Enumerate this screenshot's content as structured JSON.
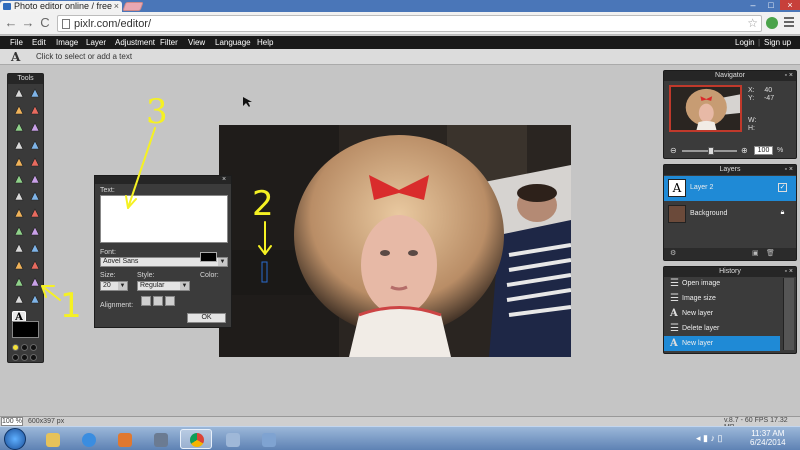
{
  "browser": {
    "tab_title": "Photo editor online / free",
    "tab_close": "×",
    "url": "pixlr.com/editor/",
    "window_controls": {
      "minimize": "–",
      "maximize": "□",
      "close": "×"
    },
    "nav": {
      "back": "←",
      "forward": "→",
      "reload": "C"
    },
    "star_icon": "☆"
  },
  "menubar": {
    "items": [
      "File",
      "Edit",
      "Image",
      "Layer",
      "Adjustment",
      "Filter",
      "View",
      "Language",
      "Help"
    ],
    "login": "Login",
    "signup": "Sign up"
  },
  "options_bar": {
    "tool_glyph": "A",
    "hint": "Click to select or add a text"
  },
  "tools_panel": {
    "title": "Tools",
    "tools": [
      "crop-icon",
      "move-icon",
      "marquee-icon",
      "lasso-icon",
      "wand-icon",
      "pencil-icon",
      "brush-icon",
      "eraser-icon",
      "bucket-icon",
      "gradient-icon",
      "stamp-icon",
      "color-replace-icon",
      "drawing-icon",
      "bloat-icon",
      "pinch-icon",
      "sharpen-icon",
      "blur-icon",
      "smudge-icon",
      "sponge-icon",
      "dodge-icon",
      "burn-icon",
      "red-eye-icon",
      "spot-heal-icon",
      "hand-icon",
      "zoom-icon",
      "picker-icon",
      "text-tool-icon"
    ],
    "fg_color": "#000000"
  },
  "text_dialog": {
    "text_label": "Text:",
    "text_value": "",
    "font_label": "Font:",
    "font_value": "Aovel Sans",
    "size_label": "Size:",
    "size_value": "20",
    "style_label": "Style:",
    "style_value": "Regular",
    "color_label": "Color:",
    "color_value": "#000000",
    "alignment_label": "Alignment:",
    "ok": "OK",
    "close": "×"
  },
  "navigator": {
    "title": "Navigator",
    "x_label": "X:",
    "x_value": "40",
    "y_label": "Y:",
    "y_value": "-47",
    "w_label": "W:",
    "w_value": "",
    "h_label": "H:",
    "h_value": "",
    "zoom": "100",
    "zoom_unit": "%"
  },
  "layers": {
    "title": "Layers",
    "items": [
      {
        "name": "Layer 2",
        "selected": true,
        "visible": true
      },
      {
        "name": "Background",
        "selected": false,
        "visible": true
      }
    ]
  },
  "history": {
    "title": "History",
    "items": [
      {
        "label": "Open image",
        "selected": false
      },
      {
        "label": "Image size",
        "selected": false
      },
      {
        "label": "New layer",
        "selected": false
      },
      {
        "label": "Delete layer",
        "selected": false
      },
      {
        "label": "New layer",
        "selected": true
      }
    ]
  },
  "status": {
    "zoom": "100",
    "zoom_unit": "%",
    "dimensions": "600x397 px",
    "version": "v.8.7 - 60 FPS 17.32 MB"
  },
  "taskbar": {
    "time": "11:37 AM",
    "date": "6/24/2014"
  },
  "annotations": {
    "one": "1",
    "two": "2",
    "three": "3",
    "color": "#f5f123"
  },
  "colors": {
    "accent": "#1f8ad6",
    "menubar": "#1a1a1a",
    "panel": "#3b3b3b",
    "workspace": "#c5c5c5"
  }
}
